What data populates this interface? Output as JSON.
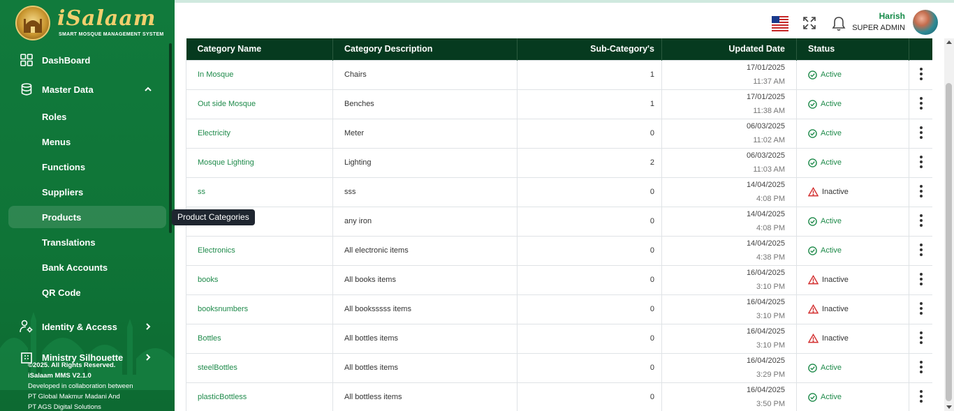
{
  "brand": {
    "name": "iSalaam",
    "tagline": "SMART MOSQUE MANAGEMENT SYSTEM"
  },
  "sidebar": {
    "items": [
      {
        "label": "DashBoard",
        "icon": "dashboard-icon"
      },
      {
        "label": "Master Data",
        "icon": "database-icon",
        "expanded": true
      },
      {
        "label": "Identity & Access",
        "icon": "user-gear-icon"
      },
      {
        "label": "Ministry Silhouette",
        "icon": "building-icon"
      }
    ],
    "sub_items": [
      "Roles",
      "Menus",
      "Functions",
      "Suppliers",
      "Products",
      "Translations",
      "Bank Accounts",
      "QR Code"
    ],
    "active_sub": "Products"
  },
  "tooltip": "Product Categories",
  "footer": {
    "copyright": "©2025. All Rights Reserved.",
    "version": "iSalaam MMS V2.1.0",
    "collab": "Developed in collaboration between",
    "org1": "PT Global Makmur Madani And",
    "org2": "PT AGS Digital Solutions"
  },
  "header": {
    "user_name": "Harish",
    "user_role": "SUPER ADMIN",
    "language_flag": "us-flag-icon"
  },
  "table": {
    "columns": [
      "Category Name",
      "Category Description",
      "Sub-Category's",
      "Updated Date",
      "Status"
    ],
    "rows": [
      {
        "name": "In Mosque",
        "desc": "Chairs",
        "subs": "1",
        "date": "17/01/2025",
        "time": "11:37 AM",
        "status": "Active"
      },
      {
        "name": "Out side Mosque",
        "desc": "Benches",
        "subs": "1",
        "date": "17/01/2025",
        "time": "11:38 AM",
        "status": "Active"
      },
      {
        "name": "Electricity",
        "desc": "Meter",
        "subs": "0",
        "date": "06/03/2025",
        "time": "11:02 AM",
        "status": "Active"
      },
      {
        "name": "Mosque Lighting",
        "desc": "Lighting",
        "subs": "2",
        "date": "06/03/2025",
        "time": "11:03 AM",
        "status": "Active"
      },
      {
        "name": "ss",
        "desc": "sss",
        "subs": "0",
        "date": "14/04/2025",
        "time": "4:08 PM",
        "status": "Inactive"
      },
      {
        "name": "",
        "desc": "any iron",
        "subs": "0",
        "date": "14/04/2025",
        "time": "4:08 PM",
        "status": "Active"
      },
      {
        "name": "Electronics",
        "desc": "All electronic items",
        "subs": "0",
        "date": "14/04/2025",
        "time": "4:38 PM",
        "status": "Active"
      },
      {
        "name": "books",
        "desc": "All books items",
        "subs": "0",
        "date": "16/04/2025",
        "time": "3:10 PM",
        "status": "Inactive"
      },
      {
        "name": "booksnumbers",
        "desc": "All booksssss items",
        "subs": "0",
        "date": "16/04/2025",
        "time": "3:10 PM",
        "status": "Inactive"
      },
      {
        "name": "Bottles",
        "desc": "All bottles items",
        "subs": "0",
        "date": "16/04/2025",
        "time": "3:10 PM",
        "status": "Inactive"
      },
      {
        "name": "steelBottles",
        "desc": "All bottles items",
        "subs": "0",
        "date": "16/04/2025",
        "time": "3:29 PM",
        "status": "Active"
      },
      {
        "name": "plasticBottless",
        "desc": "All bottless items",
        "subs": "0",
        "date": "16/04/2025",
        "time": "3:50 PM",
        "status": "Active"
      }
    ]
  },
  "colors": {
    "sidebar": "#117a3c",
    "header_row": "#063a1f",
    "active": "#1e8a4a",
    "inactive_icon": "#d32f2f",
    "user_name": "#138a47"
  }
}
